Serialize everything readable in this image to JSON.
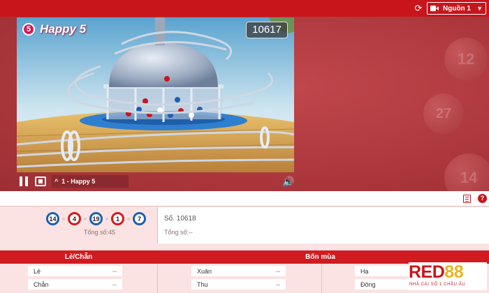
{
  "topbar": {
    "source_label": "Nguồn 1",
    "icons": {
      "refresh": "refresh-icon",
      "source": "video-camera-icon",
      "dropdown": "chevron-down-icon"
    }
  },
  "video": {
    "title": "Happy 5",
    "badge": "5",
    "round_number": "10617",
    "deco_balls": [
      "12",
      "27",
      "14"
    ]
  },
  "controls": {
    "channel_label": "1 - Happy 5",
    "channel_arrow": "^",
    "volume_glyph": "🔊",
    "icons": {
      "pause": "pause-icon",
      "camera": "camera-icon",
      "volume": "volume-icon"
    }
  },
  "toolbar2": {
    "help_label": "?",
    "icons": {
      "rules": "document-icon",
      "help": "help-icon"
    }
  },
  "result": {
    "balls": [
      {
        "value": "14",
        "color": "#1d5fb4"
      },
      {
        "value": "4",
        "color": "#d21b1b"
      },
      {
        "value": "19",
        "color": "#1d5fb4"
      },
      {
        "value": "1",
        "color": "#d21b1b"
      },
      {
        "value": "7",
        "color": "#1d5fb4"
      }
    ],
    "separator": "»",
    "total": "Tổng số:45",
    "next_round": "Số. 10618",
    "next_total": "Tổng số:--"
  },
  "bet": {
    "groups": [
      {
        "title": "Lẻ/Chẵn",
        "options": [
          {
            "label": "Lẻ",
            "odds": "--"
          },
          {
            "label": "Chẵn",
            "odds": "--"
          }
        ]
      },
      {
        "title": "Bốn mùa",
        "options": [
          {
            "label": "Xuân",
            "odds": "--"
          },
          {
            "label": "Thu",
            "odds": "--"
          },
          {
            "label": "Hạ",
            "odds": "--"
          },
          {
            "label": "Đông",
            "odds": "--"
          }
        ]
      }
    ]
  },
  "logo": {
    "text_a": "RED",
    "text_b": "88",
    "tagline": "NHÀ CÁI SỐ 1 CHÂU ÂU"
  },
  "colors": {
    "primary_red": "#c8151c",
    "ball_blue": "#1d5fb4",
    "ball_red": "#d21b1b",
    "panel_pink": "#fbe3e3"
  }
}
